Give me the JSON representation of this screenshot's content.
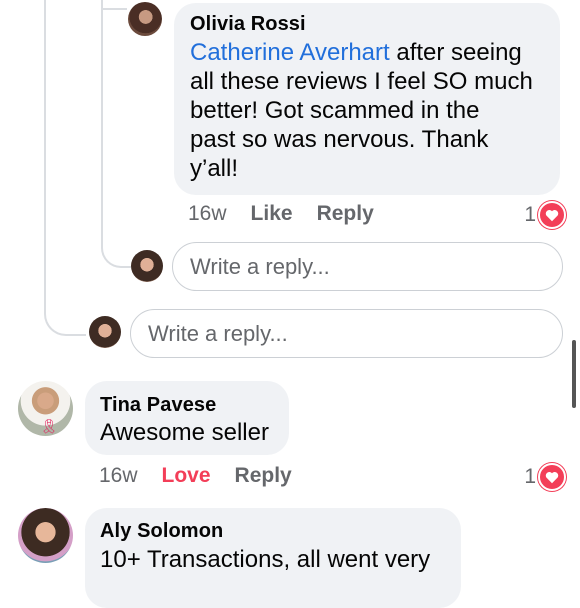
{
  "comments": {
    "olivia": {
      "author": "Olivia Rossi",
      "mention": "Catherine Averhart",
      "text_lines": [
        " after seeing",
        "all these reviews I feel SO much",
        "better! Got scammed in the",
        "past so was nervous. Thank",
        "y’all!"
      ],
      "time": "16w",
      "action_like": "Like",
      "action_reply": "Reply",
      "reaction_count": "1"
    },
    "tina": {
      "author": "Tina Pavese",
      "text": "Awesome seller",
      "time": "16w",
      "action_love": "Love",
      "action_reply": "Reply",
      "reaction_count": "1"
    },
    "aly": {
      "author": "Aly Solomon",
      "text": "10+ Transactions, all went very"
    }
  },
  "reply_inputs": {
    "inner_placeholder": "Write a reply...",
    "outer_placeholder": "Write a reply..."
  },
  "colors": {
    "mention": "#216fdb",
    "love": "#f33e58",
    "bubble": "#f0f2f5"
  }
}
